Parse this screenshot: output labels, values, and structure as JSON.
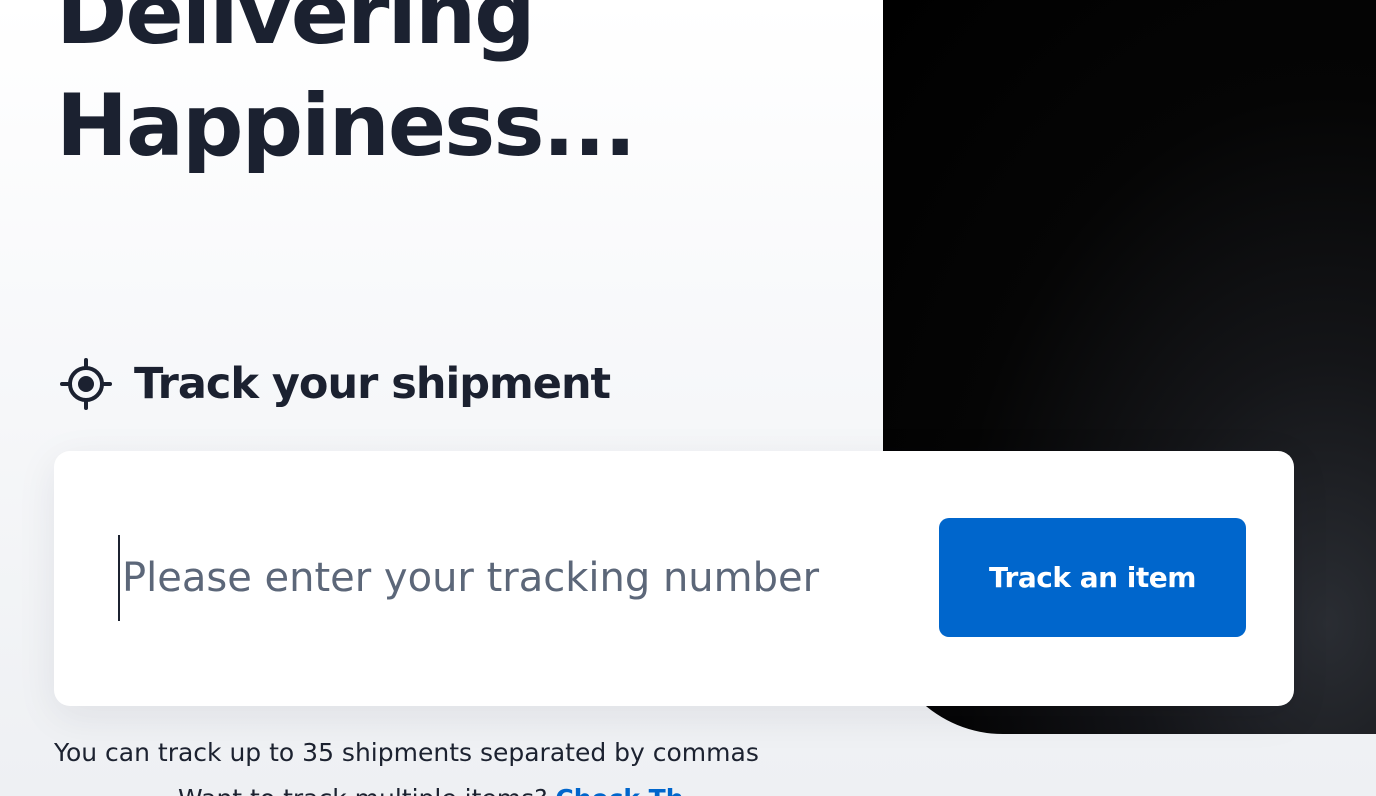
{
  "hero": {
    "headline_line1": "Delivering",
    "headline_line2": "Happiness..."
  },
  "tracking": {
    "heading": "Track your shipment",
    "heading_icon": "crosshair-target-icon",
    "input_placeholder": "Please enter your tracking number",
    "input_value": "",
    "button_label": "Track an item",
    "helper_text": "You can track up to 35 shipments separated by commas",
    "multi_prefix": "Want to track multiple items? ",
    "multi_link": "Check Th"
  },
  "colors": {
    "accent": "#0066cc",
    "text": "#1c2230",
    "placeholder": "#5c6779",
    "dark_panel": "#000000"
  }
}
